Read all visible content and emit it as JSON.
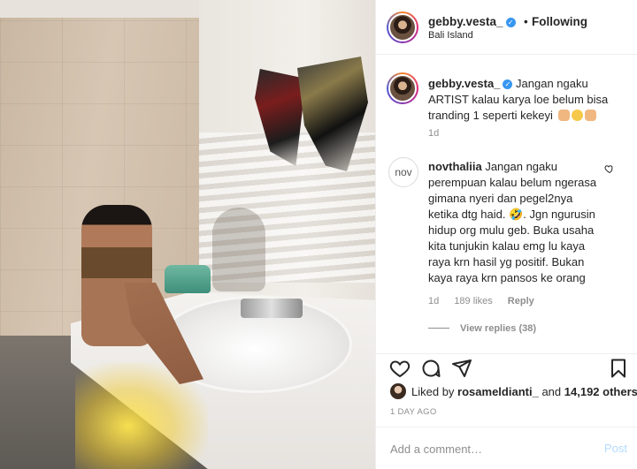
{
  "post": {
    "image_alt": "Bathroom photo"
  },
  "header": {
    "username": "gebby.vesta_",
    "dot": "•",
    "follow_status": "Following",
    "location": "Bali Island"
  },
  "caption": {
    "username": "gebby.vesta_",
    "text": "Jangan ngaku ARTIST kalau karya loe belum bisa tranding 1 seperti kekeyi",
    "time": "1d"
  },
  "comment": {
    "avatar_text": "nov",
    "username": "novthaliia",
    "text": "Jangan ngaku perempuan kalau belum ngerasa gimana nyeri dan pegel2nya ketika dtg haid. 🤣. Jgn ngurusin hidup org mulu geb. Buka usaha kita tunjukin kalau emg lu kaya raya krn hasil yg positif. Bukan kaya raya krn pansos ke orang",
    "time": "1d",
    "likes": "189 likes",
    "reply_label": "Reply",
    "view_replies": "View replies (38)"
  },
  "likes": {
    "prefix": "Liked by",
    "user": "rosameldianti_",
    "middle": "and",
    "others": "14,192 others"
  },
  "date": "1 DAY AGO",
  "add_comment": {
    "placeholder": "Add a comment…",
    "post_label": "Post"
  },
  "colors": {
    "link_blue": "#3897f0",
    "post_disabled": "#b3dbff",
    "text": "#262626",
    "secondary": "#8e8e8e"
  },
  "icons": [
    "verified-badge-icon",
    "heart-icon",
    "comment-icon",
    "share-icon",
    "bookmark-icon"
  ]
}
